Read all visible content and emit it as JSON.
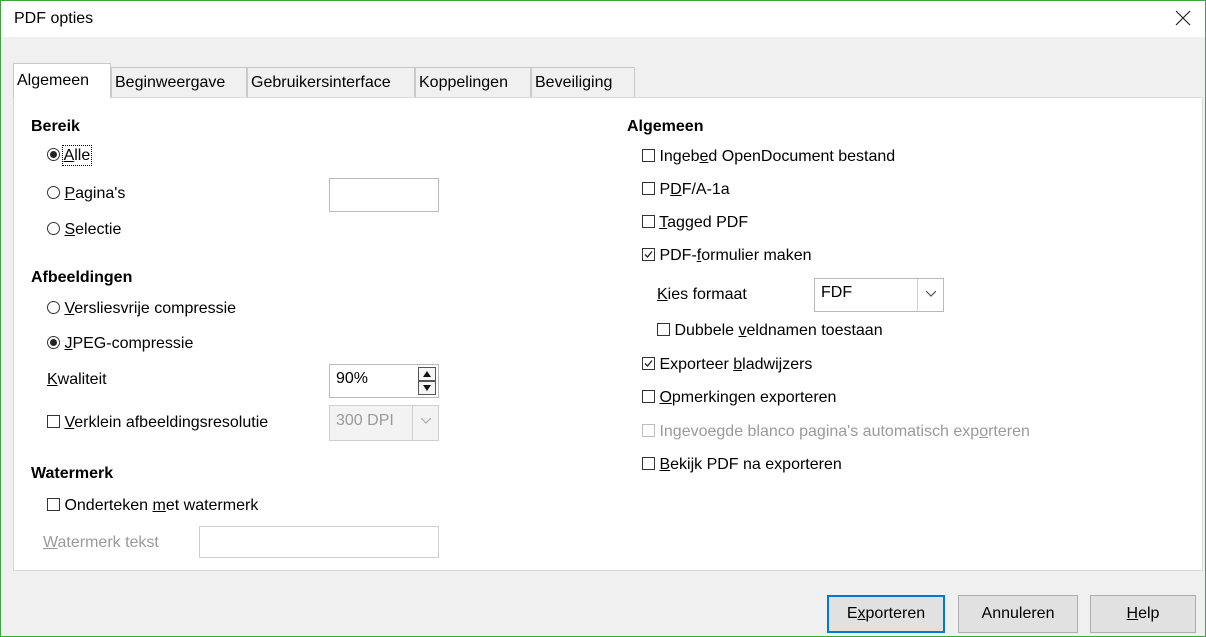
{
  "window": {
    "title": "PDF opties",
    "close_icon": "close-icon"
  },
  "tabs": [
    {
      "label": "Algemeen",
      "active": true
    },
    {
      "label": "Beginweergave"
    },
    {
      "label": "Gebruikersinterface"
    },
    {
      "label": "Koppelingen"
    },
    {
      "label": "Beveiliging"
    }
  ],
  "range": {
    "title": "Bereik",
    "all": {
      "label": "Alle",
      "u": "A",
      "rest": "lle"
    },
    "pages": {
      "label": "Pagina's",
      "u": "P",
      "rest": "agina's",
      "value": ""
    },
    "selection": {
      "label": "Selectie",
      "u": "S",
      "rest": "electie"
    }
  },
  "images": {
    "title": "Afbeeldingen",
    "lossless": {
      "label": "Versliesvrije compressie",
      "u": "V",
      "rest": "ersliesvrije compressie"
    },
    "jpeg": {
      "label": "JPEG-compressie",
      "u": "J",
      "rest": "PEG-compressie"
    },
    "quality": {
      "label": "Kwaliteit",
      "u": "K",
      "rest": "waliteit",
      "value": "90%"
    },
    "reduce": {
      "label": "Verklein afbeeldingsresolutie",
      "u": "V",
      "rest": "erklein afbeeldingsresolutie",
      "value": "300 DPI"
    }
  },
  "watermark": {
    "title": "Watermerk",
    "sign": {
      "pre": "Onderteken ",
      "u": "m",
      "rest": "et watermerk"
    },
    "text": {
      "u": "W",
      "rest": "atermerk tekst",
      "value": ""
    }
  },
  "general": {
    "title": "Algemeen",
    "embed": {
      "pre": "Ingeb",
      "u": "e",
      "rest": "d OpenDocument bestand"
    },
    "pdfa": {
      "pre": "P",
      "u": "D",
      "rest": "F/A-1a"
    },
    "tagged": {
      "pre": "",
      "u": "T",
      "rest": "agged PDF"
    },
    "form": {
      "pre": "PDF-",
      "u": "f",
      "rest": "ormulier maken"
    },
    "format": {
      "u": "K",
      "rest": "ies formaat",
      "value": "FDF"
    },
    "duplicate": {
      "pre": "Dubbele ",
      "u": "v",
      "rest": "eldnamen toestaan"
    },
    "bookmarks": {
      "pre": "Exporteer ",
      "u": "b",
      "rest": "ladwijzers"
    },
    "comments": {
      "pre": "",
      "u": "O",
      "rest": "pmerkingen exporteren"
    },
    "blank": {
      "pre": "Ingevoegde blanco pagina's automatisch exp",
      "u": "o",
      "rest": "rteren"
    },
    "view": {
      "pre": "",
      "u": "B",
      "rest": "ekijk PDF na exporteren"
    }
  },
  "buttons": {
    "export": {
      "pre": "E",
      "u": "x",
      "rest": "porteren"
    },
    "cancel": "Annuleren",
    "help": {
      "u": "H",
      "rest": "elp"
    }
  }
}
